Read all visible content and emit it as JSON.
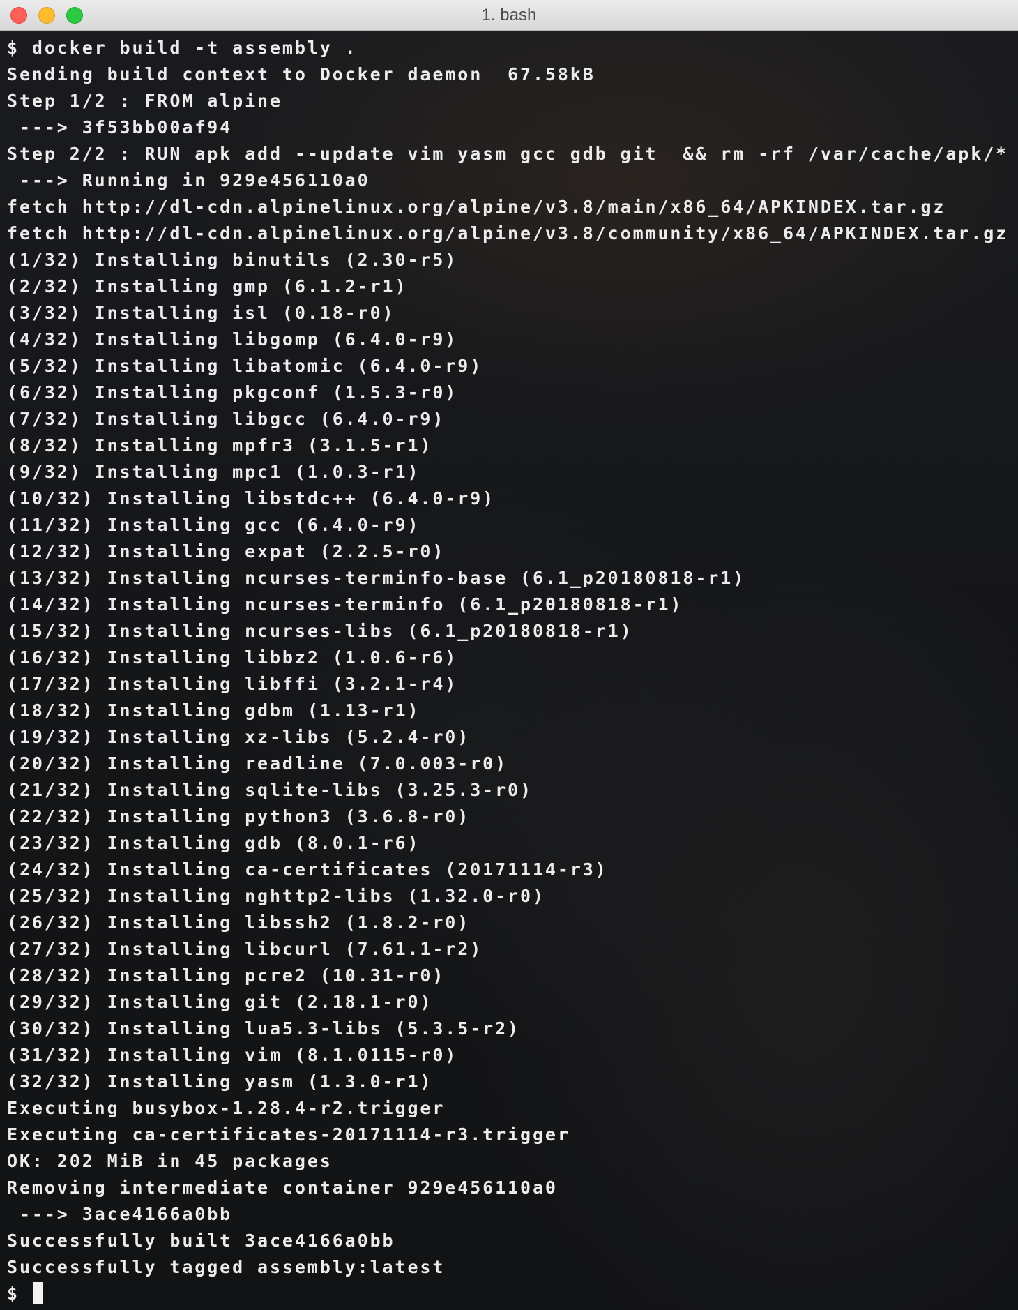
{
  "window": {
    "title": "1. bash"
  },
  "terminal": {
    "lines": [
      "$ docker build -t assembly .",
      "Sending build context to Docker daemon  67.58kB",
      "Step 1/2 : FROM alpine",
      " ---> 3f53bb00af94",
      "Step 2/2 : RUN apk add --update vim yasm gcc gdb git  && rm -rf /var/cache/apk/*",
      " ---> Running in 929e456110a0",
      "fetch http://dl-cdn.alpinelinux.org/alpine/v3.8/main/x86_64/APKINDEX.tar.gz",
      "fetch http://dl-cdn.alpinelinux.org/alpine/v3.8/community/x86_64/APKINDEX.tar.gz",
      "(1/32) Installing binutils (2.30-r5)",
      "(2/32) Installing gmp (6.1.2-r1)",
      "(3/32) Installing isl (0.18-r0)",
      "(4/32) Installing libgomp (6.4.0-r9)",
      "(5/32) Installing libatomic (6.4.0-r9)",
      "(6/32) Installing pkgconf (1.5.3-r0)",
      "(7/32) Installing libgcc (6.4.0-r9)",
      "(8/32) Installing mpfr3 (3.1.5-r1)",
      "(9/32) Installing mpc1 (1.0.3-r1)",
      "(10/32) Installing libstdc++ (6.4.0-r9)",
      "(11/32) Installing gcc (6.4.0-r9)",
      "(12/32) Installing expat (2.2.5-r0)",
      "(13/32) Installing ncurses-terminfo-base (6.1_p20180818-r1)",
      "(14/32) Installing ncurses-terminfo (6.1_p20180818-r1)",
      "(15/32) Installing ncurses-libs (6.1_p20180818-r1)",
      "(16/32) Installing libbz2 (1.0.6-r6)",
      "(17/32) Installing libffi (3.2.1-r4)",
      "(18/32) Installing gdbm (1.13-r1)",
      "(19/32) Installing xz-libs (5.2.4-r0)",
      "(20/32) Installing readline (7.0.003-r0)",
      "(21/32) Installing sqlite-libs (3.25.3-r0)",
      "(22/32) Installing python3 (3.6.8-r0)",
      "(23/32) Installing gdb (8.0.1-r6)",
      "(24/32) Installing ca-certificates (20171114-r3)",
      "(25/32) Installing nghttp2-libs (1.32.0-r0)",
      "(26/32) Installing libssh2 (1.8.2-r0)",
      "(27/32) Installing libcurl (7.61.1-r2)",
      "(28/32) Installing pcre2 (10.31-r0)",
      "(29/32) Installing git (2.18.1-r0)",
      "(30/32) Installing lua5.3-libs (5.3.5-r2)",
      "(31/32) Installing vim (8.1.0115-r0)",
      "(32/32) Installing yasm (1.3.0-r1)",
      "Executing busybox-1.28.4-r2.trigger",
      "Executing ca-certificates-20171114-r3.trigger",
      "OK: 202 MiB in 45 packages",
      "Removing intermediate container 929e456110a0",
      " ---> 3ace4166a0bb",
      "Successfully built 3ace4166a0bb",
      "Successfully tagged assembly:latest"
    ],
    "prompt": "$ "
  }
}
